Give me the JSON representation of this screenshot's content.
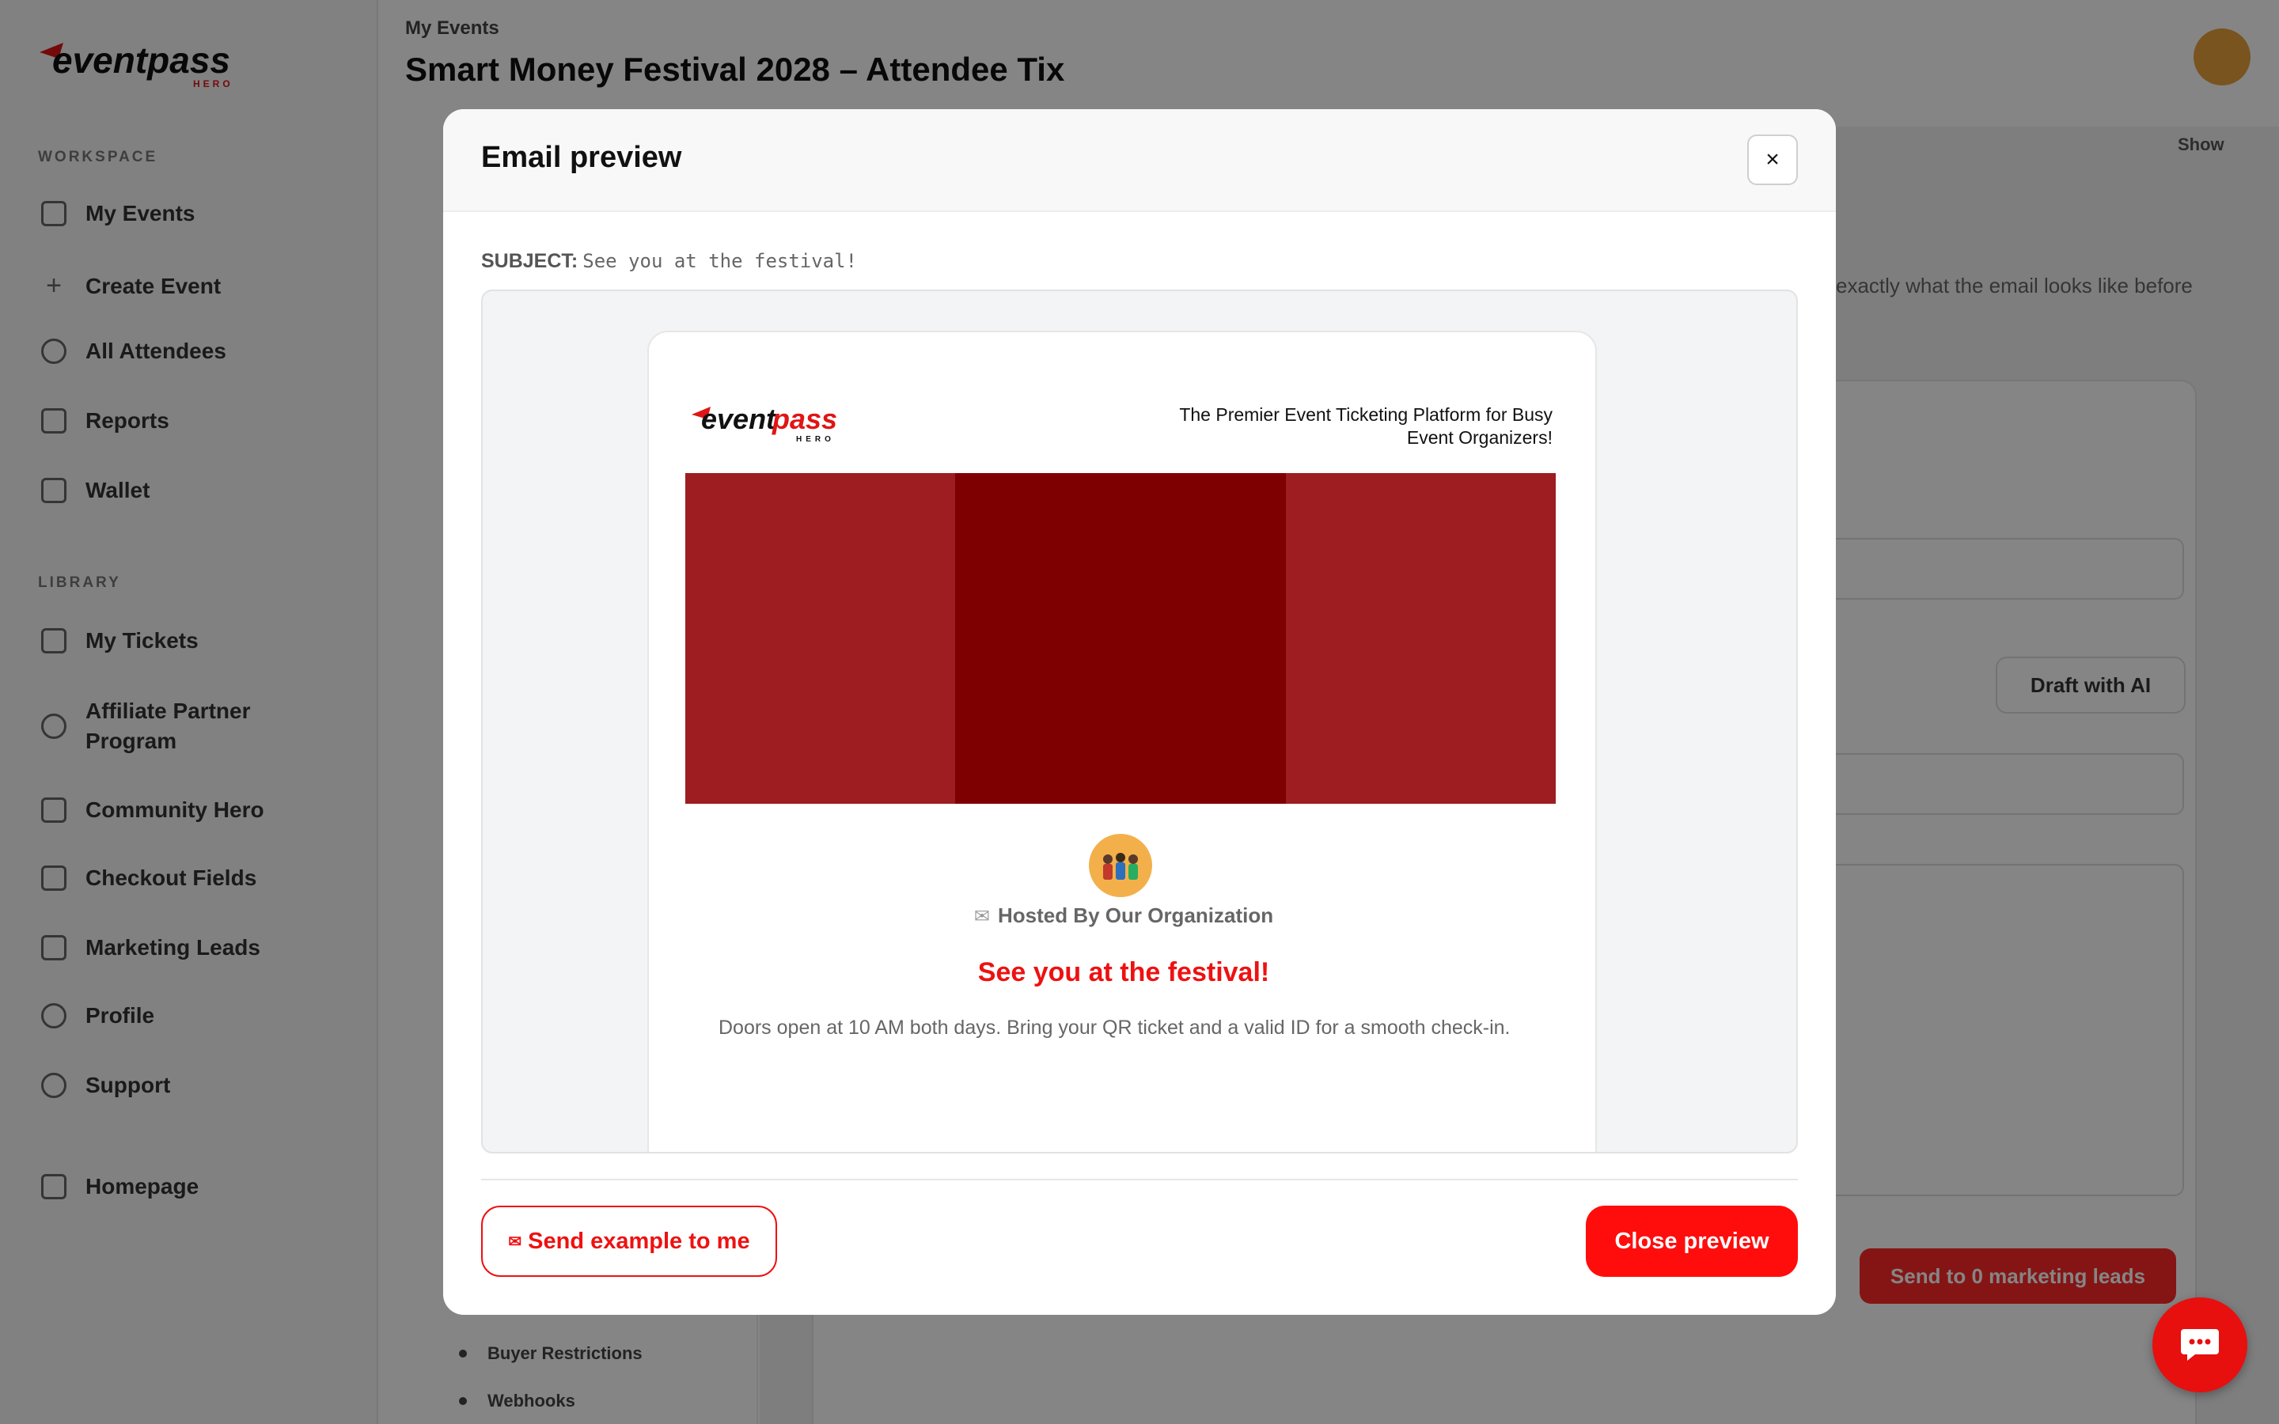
{
  "app": {
    "breadcrumb": "My Events",
    "event_title": "Smart Money Festival 2028 – Attendee Tix",
    "show_label": "Show",
    "workspace_label": "WORKSPACE",
    "library_label": "LIBRARY",
    "workspace_items": [
      {
        "label": "My Events",
        "icon": "grid-icon"
      },
      {
        "label": "Create Event",
        "icon": "plus-icon"
      },
      {
        "label": "All Attendees",
        "icon": "users-icon"
      },
      {
        "label": "Reports",
        "icon": "chart-icon"
      },
      {
        "label": "Wallet",
        "icon": "wallet-icon"
      }
    ],
    "library_items": [
      {
        "label": "My Tickets",
        "icon": "ticket-icon"
      },
      {
        "label": "Affiliate Partner Program",
        "icon": "trophy-icon"
      },
      {
        "label": "Community Hero",
        "icon": "megaphone-icon"
      },
      {
        "label": "Checkout Fields",
        "icon": "clipboard-icon"
      },
      {
        "label": "Marketing Leads",
        "icon": "mail-icon"
      },
      {
        "label": "Profile",
        "icon": "user-icon"
      },
      {
        "label": "Support",
        "icon": "support-icon"
      }
    ],
    "homepage_label": "Homepage",
    "sub_items": [
      "Buyer Restrictions",
      "Webhooks"
    ],
    "bg_hint_text": "exactly what the email looks like before",
    "draft_ai_label": "Draft with AI",
    "send_leads_label": "Send to 0 marketing leads"
  },
  "modal": {
    "title": "Email preview",
    "close_icon": "×",
    "subject_label": "SUBJECT:",
    "subject_value": "See you at the festival!",
    "email": {
      "brand_name": "eventpass",
      "brand_sub": "HERO",
      "tagline": "The Premier Event Ticketing Platform for Busy Event Organizers!",
      "hosted_by": "Hosted By Our Organization",
      "headline": "See you at the festival!",
      "body": "Doors open at 10 AM both days. Bring your QR ticket and a valid ID for a smooth check-in."
    },
    "send_example_label": "Send example to me",
    "close_preview_label": "Close preview"
  },
  "colors": {
    "brand_red": "#ee1111",
    "banner_side": "#9e1d20",
    "banner_center": "#7f0000"
  }
}
